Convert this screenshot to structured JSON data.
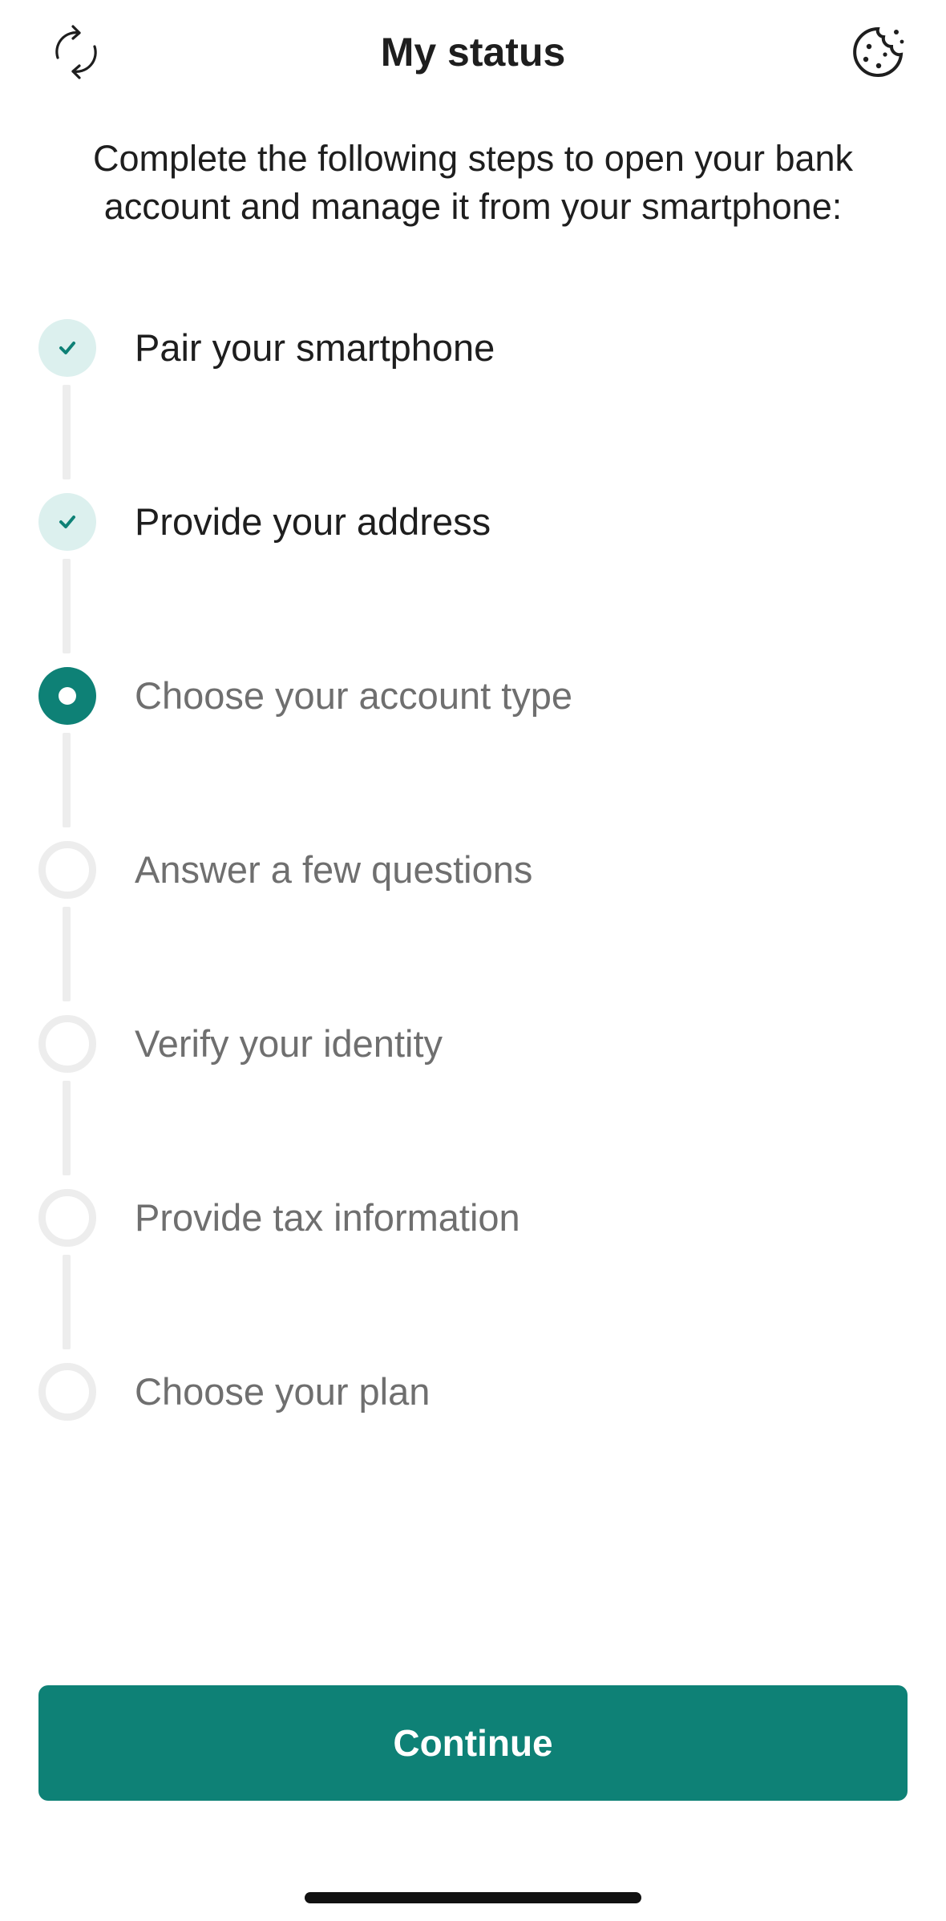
{
  "header": {
    "title": "My status",
    "left_icon": "refresh-icon",
    "right_icon": "cookie-icon"
  },
  "intro": {
    "text": "Complete the following steps to open your bank account and manage it from your smartphone:"
  },
  "steps": [
    {
      "label": "Pair your smartphone",
      "state": "done"
    },
    {
      "label": "Provide your address",
      "state": "done"
    },
    {
      "label": "Choose your account type",
      "state": "current"
    },
    {
      "label": "Answer a few questions",
      "state": "pending"
    },
    {
      "label": "Verify your identity",
      "state": "pending"
    },
    {
      "label": "Provide tax information",
      "state": "pending"
    },
    {
      "label": "Choose your plan",
      "state": "pending"
    }
  ],
  "actions": {
    "continue_label": "Continue"
  },
  "colors": {
    "accent": "#0e8176",
    "done_bg": "#dcf0ee",
    "pending_ring": "#ededed",
    "text_primary": "#1e1e1e",
    "text_secondary": "#6f6f6f"
  }
}
